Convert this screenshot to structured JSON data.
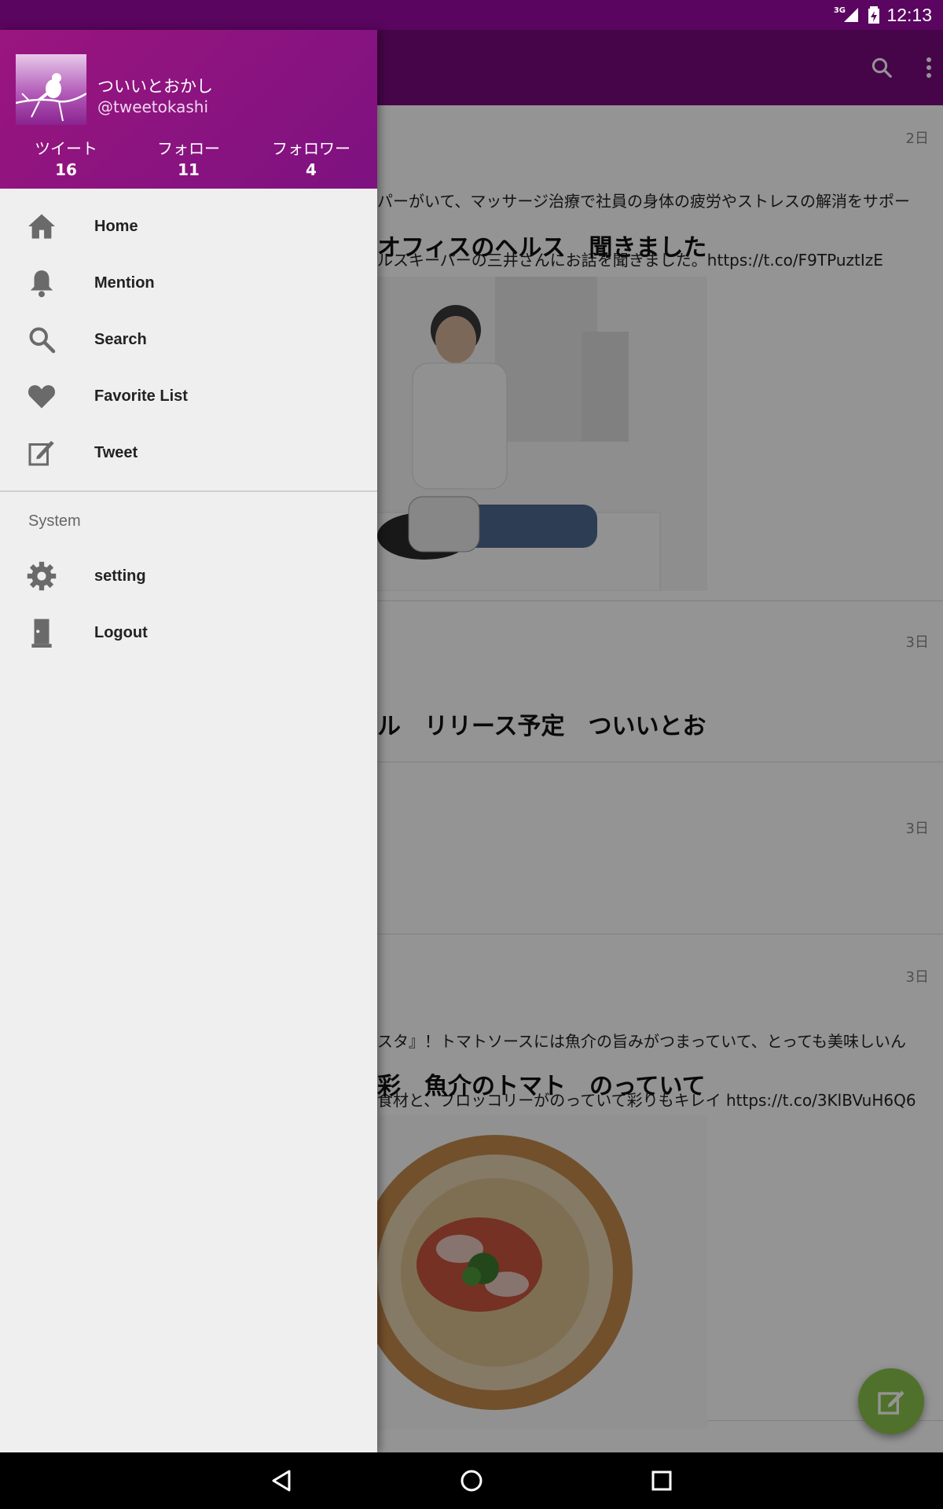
{
  "status_bar": {
    "time": "12:13",
    "network": "3G"
  },
  "toolbar": {
    "search_icon": "search-icon",
    "overflow_icon": "more-vert-icon"
  },
  "timeline": [
    {
      "time": "2日",
      "line1": "パーがいて、マッサージ治療で社員の身体の疲労やストレスの解消をサポー",
      "line2": "ルスキーパーの三井さんにお話を聞きました。https://t.co/F9TPuztIzE",
      "heading": "オフィスのヘルス　聞きました"
    },
    {
      "time": "3日",
      "heading": "ル　リリース予定　ついいとお"
    },
    {
      "time": "3日"
    },
    {
      "time": "3日",
      "line1": "スタ』！トマトソースには魚介の旨みがつまっていて、とっても美味しいん",
      "line2": "食材と、ブロッコリーがのっていて彩りもキレイ https://t.co/3KlBVuH6Q6",
      "heading": "彩　魚介のトマト　のっていて"
    }
  ],
  "drawer": {
    "user": {
      "name": "ついいとおかし",
      "handle": "@tweetokashi",
      "stats": [
        {
          "label": "ツイート",
          "value": "16"
        },
        {
          "label": "フォロー",
          "value": "11"
        },
        {
          "label": "フォロワー",
          "value": "4"
        }
      ]
    },
    "menu": [
      {
        "label": "Home",
        "icon": "home-icon"
      },
      {
        "label": "Mention",
        "icon": "bell-icon"
      },
      {
        "label": "Search",
        "icon": "search-icon"
      },
      {
        "label": "Favorite List",
        "icon": "heart-icon"
      },
      {
        "label": "Tweet",
        "icon": "compose-icon"
      }
    ],
    "system_header": "System",
    "system_menu": [
      {
        "label": "setting",
        "icon": "gear-icon"
      },
      {
        "label": "Logout",
        "icon": "door-icon"
      }
    ]
  },
  "fab": {
    "icon": "compose-icon"
  },
  "nav_bar": {
    "back": "back-icon",
    "home": "home-circle-icon",
    "recents": "recents-icon"
  },
  "colors": {
    "primary": "#7a0a7f",
    "primary_dark": "#5a0560",
    "accent": "#8bc34a",
    "drawer_bg": "#efefef"
  }
}
